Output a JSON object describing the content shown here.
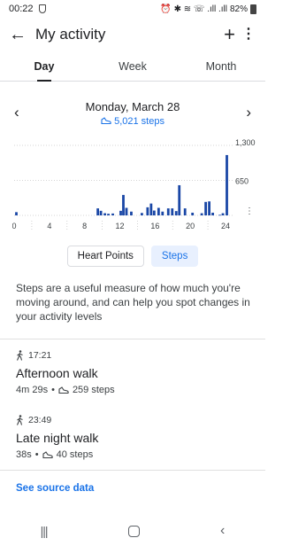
{
  "status_bar": {
    "time": "00:22",
    "battery": "82%",
    "icons": "⏰ ✱ ≋ ☏ .ıll .ıll"
  },
  "app_bar": {
    "back_icon": "←",
    "title": "My activity",
    "add_icon": "+",
    "more_icon": "⋮"
  },
  "tabs": [
    {
      "label": "Day",
      "active": true
    },
    {
      "label": "Week",
      "active": false
    },
    {
      "label": "Month",
      "active": false
    }
  ],
  "date_nav": {
    "prev_icon": "‹",
    "next_icon": "›",
    "date": "Monday, March 28",
    "steps": "5,021 steps",
    "steps_icon": "shoe-icon"
  },
  "chart_data": {
    "type": "bar",
    "x": [
      0.25,
      9.5,
      9.85,
      10.3,
      10.7,
      11.2,
      12.1,
      12.4,
      12.75,
      13.3,
      14.5,
      15.15,
      15.55,
      15.9,
      16.4,
      16.85,
      17.5,
      17.95,
      18.4,
      18.75,
      19.4,
      20.25,
      21.3,
      21.75,
      22.15,
      22.55,
      23.35,
      23.7,
      24.15
    ],
    "values": [
      60,
      130,
      85,
      40,
      30,
      35,
      85,
      380,
      140,
      70,
      45,
      150,
      220,
      90,
      140,
      70,
      130,
      130,
      80,
      560,
      130,
      50,
      40,
      250,
      260,
      50,
      10,
      40,
      1120
    ],
    "xticks": [
      "0",
      "4",
      "8",
      "12",
      "16",
      "20",
      "24"
    ],
    "xtick_values": [
      0,
      4,
      8,
      12,
      16,
      20,
      24
    ],
    "yticks": [
      "650",
      "1,300"
    ],
    "ytick_values": [
      650,
      1300
    ],
    "xlim": [
      0,
      24.5
    ],
    "ylim": [
      0,
      1300
    ],
    "color": "#1a47a6",
    "grid": "horizontal dotted"
  },
  "chips": [
    {
      "label": "Heart Points",
      "active": false
    },
    {
      "label": "Steps",
      "active": true
    }
  ],
  "description": "Steps are a useful measure of how much you're moving around, and can help you spot changes in your activity levels",
  "sessions": [
    {
      "time": "17:21",
      "name": "Afternoon walk",
      "duration": "4m 29s",
      "separator": "•",
      "steps": "259 steps"
    },
    {
      "time": "23:49",
      "name": "Late night walk",
      "duration": "38s",
      "separator": "•",
      "steps": "40 steps"
    }
  ],
  "source_link": "See source data",
  "nav": {
    "recents_icon": "|||",
    "back_icon": "‹"
  },
  "colors": {
    "accent": "#1a73e8",
    "bar": "#1a47a6",
    "chip_active_bg": "#e8f0fe"
  }
}
